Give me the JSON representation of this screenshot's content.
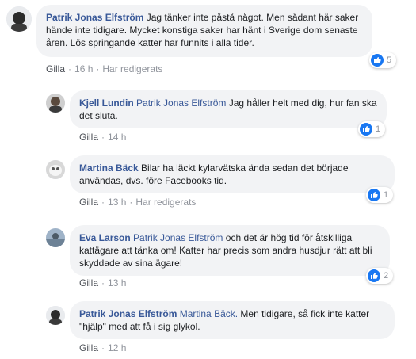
{
  "comments": [
    {
      "author": "Patrik Jonas Elfström",
      "mention": "",
      "text": "Jag tänker inte påstå något. Men sådant här saker hände inte tidigare. Mycket konstiga saker har hänt i Sverige dom senaste åren. Lös springande katter har funnits i alla tider.",
      "like_label": "Gilla",
      "time": "16 h",
      "edited": "Har redigerats",
      "reaction_count": "5",
      "reaction_icon": "like-icon",
      "avatar_icon": "user-avatar"
    },
    {
      "author": "Kjell Lundin",
      "mention": "Patrik Jonas Elfström",
      "text": "Jag håller helt med dig, hur fan ska det sluta.",
      "like_label": "Gilla",
      "time": "14 h",
      "edited": "",
      "reaction_count": "1",
      "reaction_icon": "like-icon",
      "avatar_icon": "user-avatar"
    },
    {
      "author": "Martina Bäck",
      "mention": "",
      "text": "Bilar ha läckt kylarvätska ända sedan det började användas, dvs. före Facebooks tid.",
      "like_label": "Gilla",
      "time": "13 h",
      "edited": "Har redigerats",
      "reaction_count": "1",
      "reaction_icon": "like-icon",
      "avatar_icon": "user-avatar"
    },
    {
      "author": "Eva Larson",
      "mention": "Patrik Jonas Elfström",
      "text": "och det är hög tid för åtskilliga kattägare att tänka om! Katter har precis som andra husdjur rätt att bli skyddade av sina ägare!",
      "like_label": "Gilla",
      "time": "13 h",
      "edited": "",
      "reaction_count": "2",
      "reaction_icon": "like-icon",
      "avatar_icon": "user-avatar"
    },
    {
      "author": "Patrik Jonas Elfström",
      "mention": "Martina Bäck.",
      "text": "Men tidigare, så fick inte katter \"hjälp\" med att få i sig glykol.",
      "like_label": "Gilla",
      "time": "12 h",
      "edited": "",
      "reaction_count": "",
      "reaction_icon": "",
      "avatar_icon": "user-avatar"
    }
  ],
  "colors": {
    "link": "#385898",
    "bubble": "#f2f3f5",
    "meta": "#90949c",
    "like_blue": "#1877f2"
  }
}
